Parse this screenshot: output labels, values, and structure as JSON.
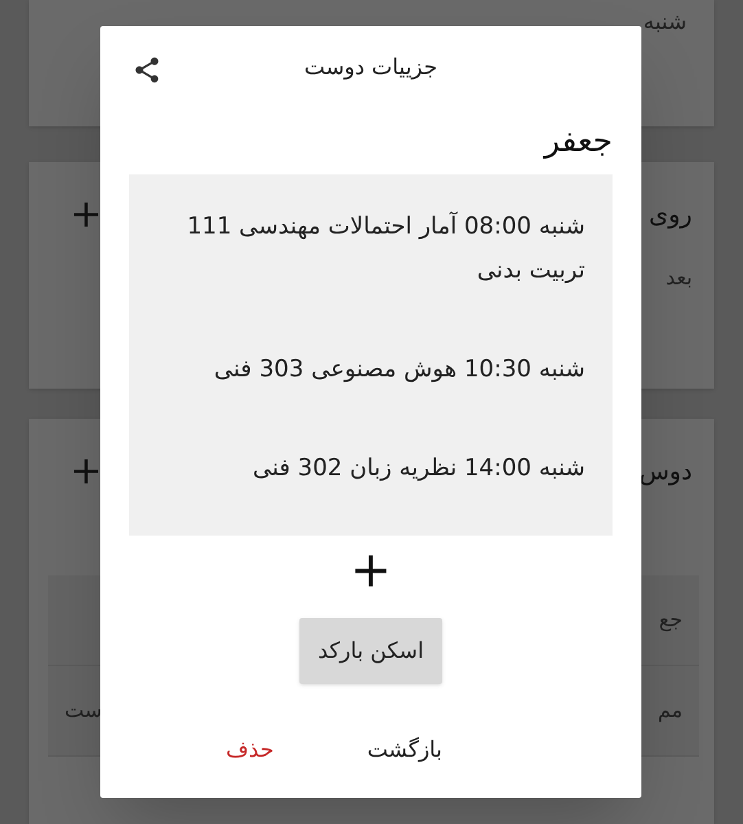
{
  "background": {
    "schedule_card": {
      "line": "شنبه"
    },
    "events_card": {
      "title": "روی",
      "subtitle": "بعد",
      "add_label": "+"
    },
    "friends_card": {
      "title": "دوس",
      "add_label": "+",
      "rows": [
        {
          "cells": [
            "جع"
          ]
        },
        {
          "cells": [
            "مم",
            "ست"
          ]
        }
      ]
    }
  },
  "dialog": {
    "title": "جزییات دوست",
    "name": "جعفر",
    "classes": [
      {
        "text": "شنبه 08:00 آمار احتمالات مهندسی 111 تربیت بدنی"
      },
      {
        "text": "شنبه 10:30 هوش مصنوعی 303 فنی"
      },
      {
        "text": "شنبه 14:00 نظریه زبان 302 فنی"
      }
    ],
    "add_label": "+",
    "scan_button": "اسکن بارکد",
    "actions": [
      {
        "label": "بازگشت",
        "kind": "neutral"
      },
      {
        "label": "حذف",
        "kind": "danger"
      }
    ]
  }
}
